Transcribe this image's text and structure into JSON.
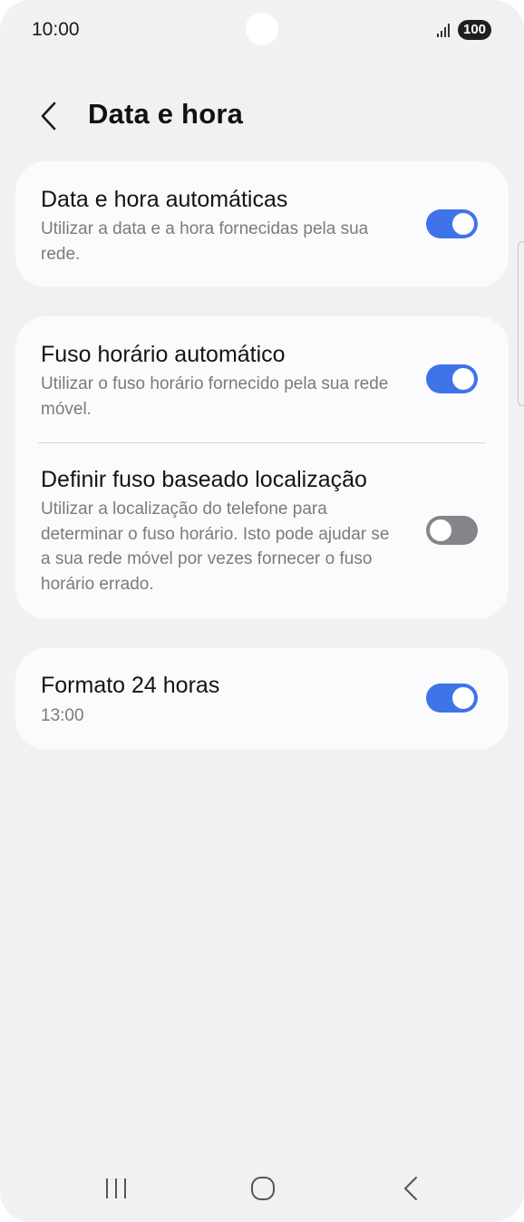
{
  "status_bar": {
    "time": "10:00",
    "battery": "100",
    "signal_icon": "signal-bars-icon"
  },
  "header": {
    "back_icon": "chevron-left-icon",
    "title": "Data e hora"
  },
  "settings": [
    {
      "title": "Data e hora automáticas",
      "description": "Utilizar a data e a hora fornecidas pela sua rede.",
      "enabled": true
    },
    {
      "title": "Fuso horário automático",
      "description": "Utilizar o fuso horário fornecido pela sua rede móvel.",
      "enabled": true
    },
    {
      "title": "Definir fuso baseado localização",
      "description": "Utilizar a localização do telefone para determinar o fuso horário. Isto pode ajudar se a sua rede móvel por vezes fornecer o fuso horário errado.",
      "enabled": false
    },
    {
      "title": "Formato 24 horas",
      "description": "13:00",
      "enabled": true
    }
  ],
  "nav_bar": {
    "recents_icon": "recent-apps-icon",
    "home_icon": "home-icon",
    "back_icon": "back-icon"
  },
  "colors": {
    "toggle_on": "#3e74e8",
    "toggle_off": "#858589",
    "background": "#f1f1f3",
    "card": "#fbfbfd"
  }
}
